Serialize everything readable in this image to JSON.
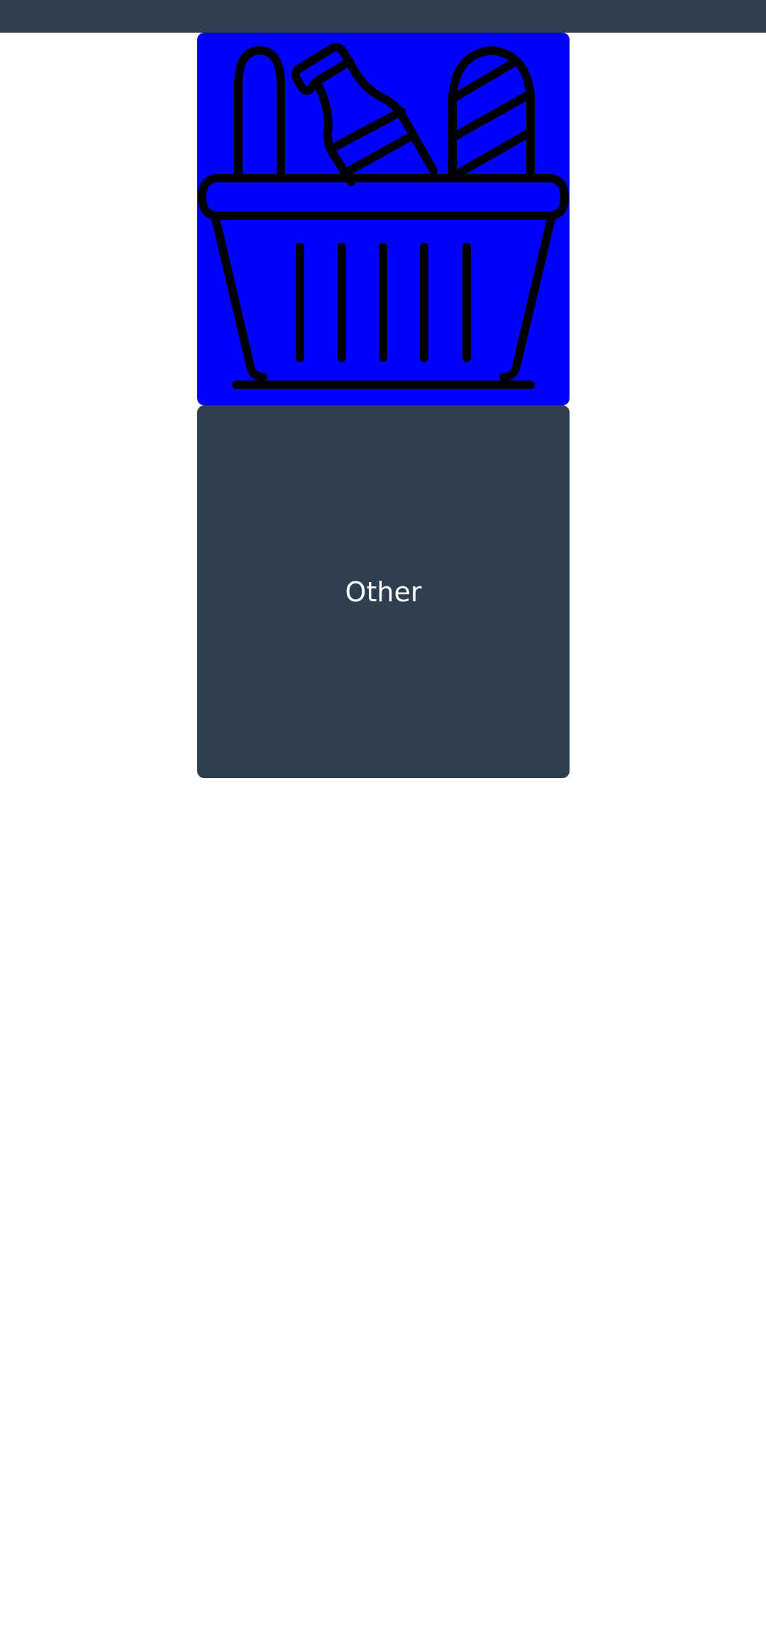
{
  "colors": {
    "header_bg": "#2c3e50",
    "image_tile_bg": "#0000ff",
    "text_tile_bg": "#2c3e50",
    "label_color": "#ffffff",
    "icon_stroke": "#000000"
  },
  "tiles": [
    {
      "kind": "image",
      "icon": "grocery-basket-icon"
    },
    {
      "kind": "text",
      "label": "Other"
    }
  ]
}
